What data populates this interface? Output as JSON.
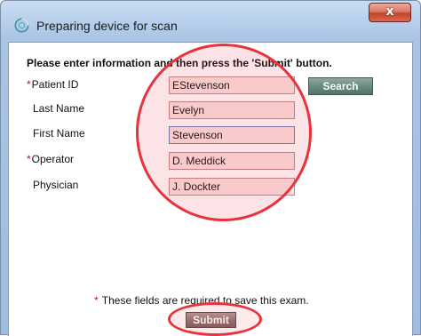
{
  "window": {
    "title": "Preparing device for scan",
    "close_glyph": "x"
  },
  "form": {
    "instruction": "Please enter information and then press the 'Submit' button.",
    "required_marker": "*",
    "fields": [
      {
        "label": "Patient ID",
        "value": "EStevenson",
        "required": true
      },
      {
        "label": "Last Name",
        "value": "Evelyn",
        "required": false
      },
      {
        "label": "First Name",
        "value": "Stevenson",
        "required": false
      },
      {
        "label": "Operator",
        "value": "D. Meddick",
        "required": true
      },
      {
        "label": "Physician",
        "value": "J. Dockter",
        "required": false
      }
    ],
    "search_label": "Search",
    "footnote": "These fields are required to save this exam.",
    "submit_label": "Submit"
  },
  "colors": {
    "highlight_circle": "#e8323c",
    "required_star": "#cc1111",
    "input_fill": "#fbe2e2"
  }
}
